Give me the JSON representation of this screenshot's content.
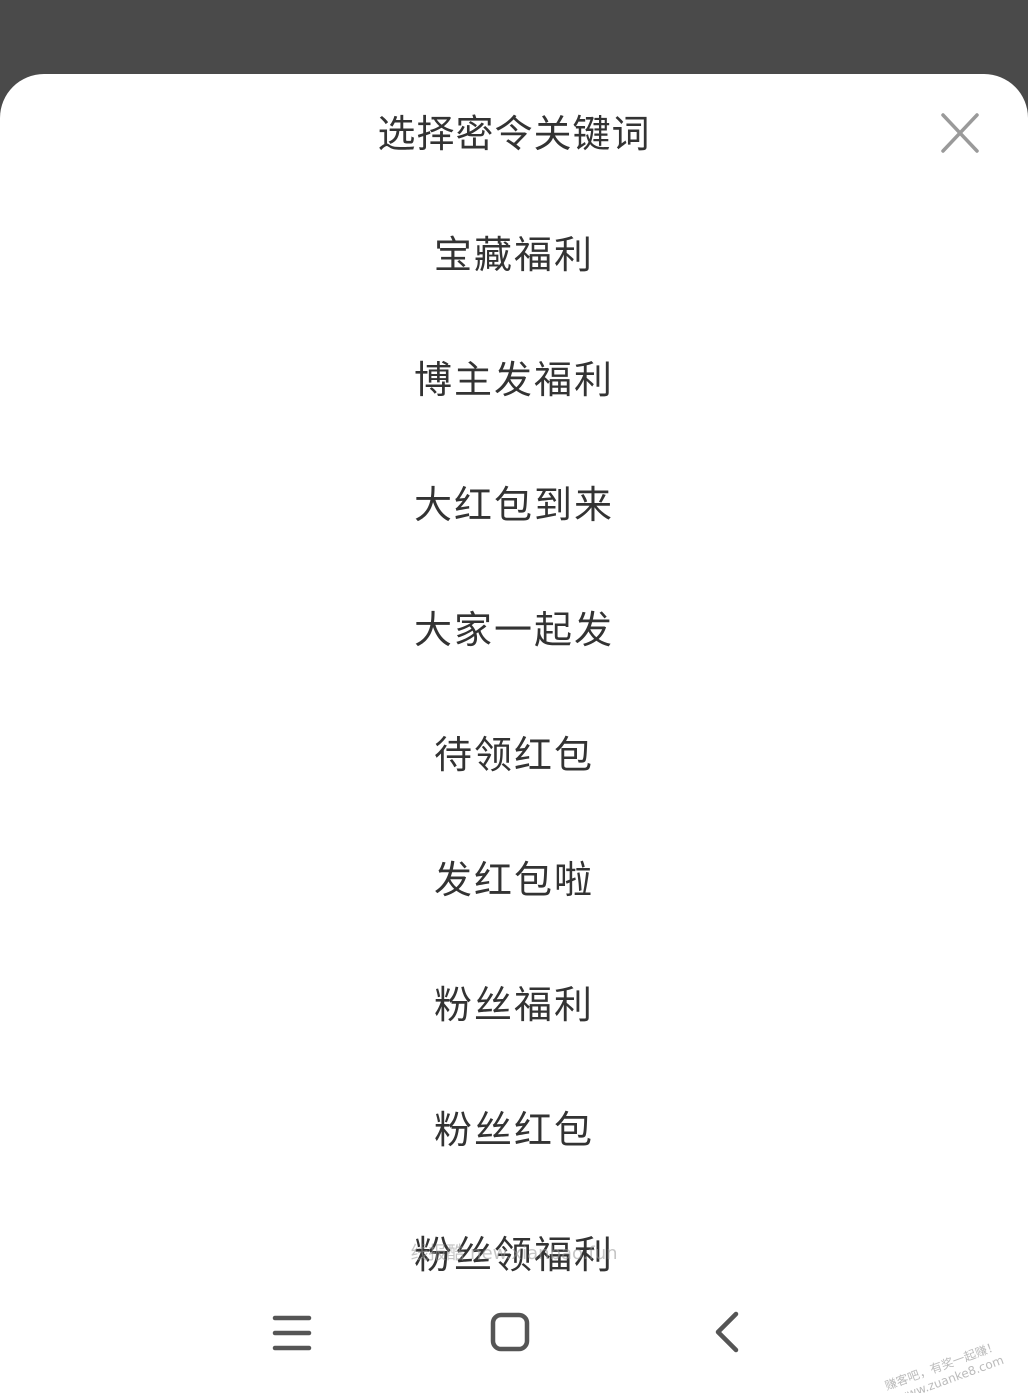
{
  "sheet": {
    "title": "选择密令关键词"
  },
  "options": [
    "宝藏福利",
    "博主发福利",
    "大红包到来",
    "大家一起发",
    "待领红包",
    "发红包啦",
    "粉丝福利",
    "粉丝红包",
    "粉丝领福利"
  ],
  "watermarks": {
    "center": "线报酷 new.xianbao.fun",
    "corner_line1": "赚客吧，有奖一起赚！",
    "corner_line2": "www.zuanke8.com"
  },
  "icons": {
    "close": "close-icon",
    "menu": "menu-icon",
    "home": "home-icon",
    "back": "back-icon"
  },
  "colors": {
    "backdrop": "#4a4a4a",
    "sheet": "#ffffff",
    "text": "#333333",
    "icon": "#555555"
  }
}
